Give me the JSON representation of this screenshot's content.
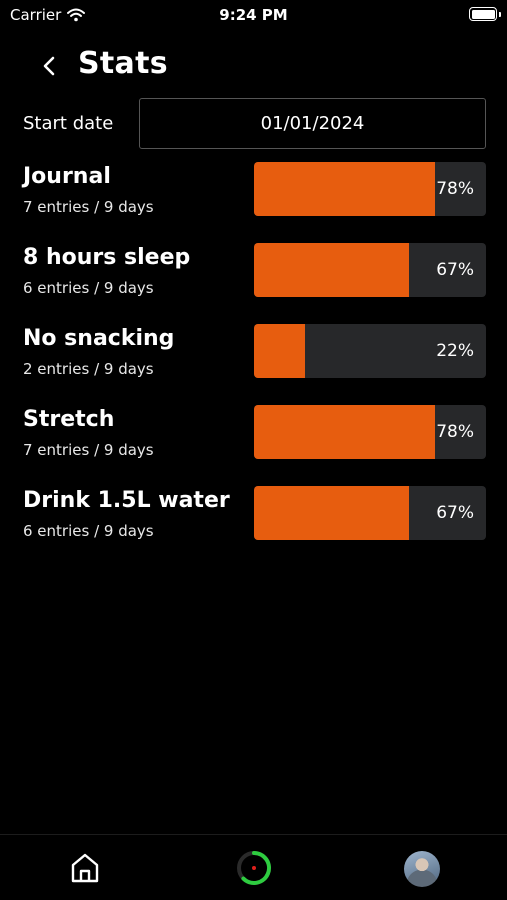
{
  "status_bar": {
    "carrier": "Carrier",
    "time": "9:24 PM"
  },
  "header": {
    "title": "Stats",
    "back_icon": "chevron-left-icon"
  },
  "start_date": {
    "label": "Start date",
    "value": "01/01/2024"
  },
  "stats": [
    {
      "name": "Journal",
      "entries": "7 entries / 9 days",
      "percent_label": "78%",
      "fraction": 0.78
    },
    {
      "name": "8 hours sleep",
      "entries": "6 entries / 9 days",
      "percent_label": "67%",
      "fraction": 0.67
    },
    {
      "name": "No snacking",
      "entries": "2 entries / 9 days",
      "percent_label": "22%",
      "fraction": 0.22
    },
    {
      "name": "Stretch",
      "entries": "7 entries / 9 days",
      "percent_label": "78%",
      "fraction": 0.78
    },
    {
      "name": "Drink 1.5L water",
      "entries": "6 entries / 9 days",
      "percent_label": "67%",
      "fraction": 0.67
    }
  ],
  "tabbar": {
    "items": [
      "home-icon",
      "progress-ring-icon",
      "avatar"
    ]
  },
  "colors": {
    "accent": "#e75d0f",
    "bar_track": "#27282a",
    "progress_ring": "#2ecc40",
    "progress_dot": "#e0201c"
  }
}
